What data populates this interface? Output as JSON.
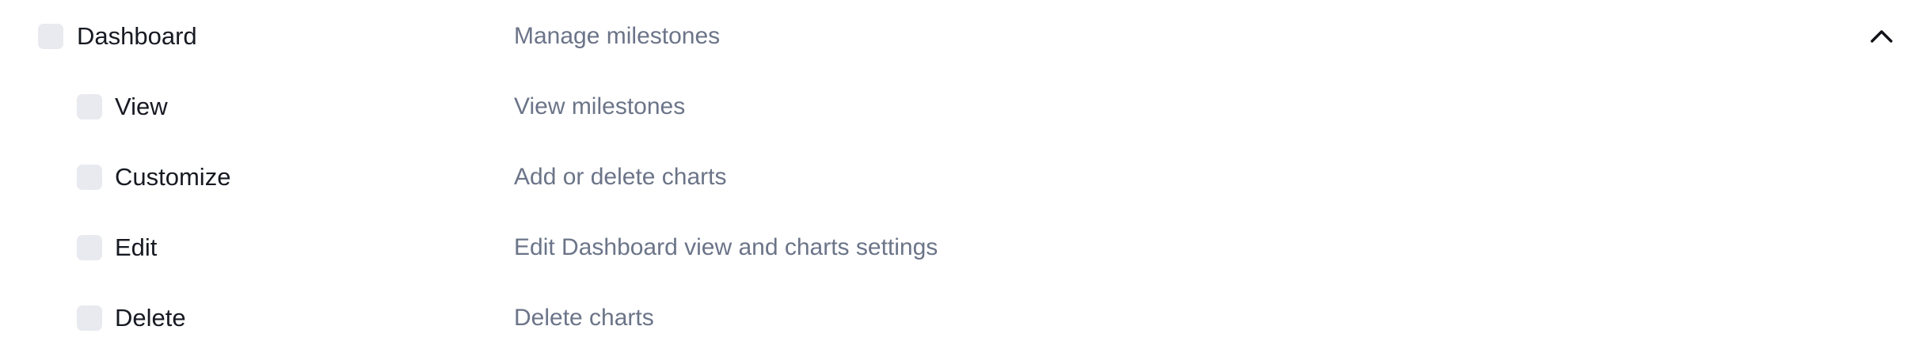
{
  "group": {
    "label": "Dashboard",
    "description": "Manage milestones",
    "checked": false,
    "expanded": true,
    "toggle_icon": "chevron-up-icon"
  },
  "permissions": [
    {
      "label": "View",
      "description": "View milestones",
      "checked": false
    },
    {
      "label": "Customize",
      "description": "Add or delete charts",
      "checked": false
    },
    {
      "label": "Edit",
      "description": "Edit Dashboard view and charts settings",
      "checked": false
    },
    {
      "label": "Delete",
      "description": "Delete charts",
      "checked": false
    }
  ],
  "colors": {
    "label_text": "#171a22",
    "description_text": "#6b7488",
    "checkbox_fill": "#e8eaef",
    "background": "#ffffff"
  }
}
